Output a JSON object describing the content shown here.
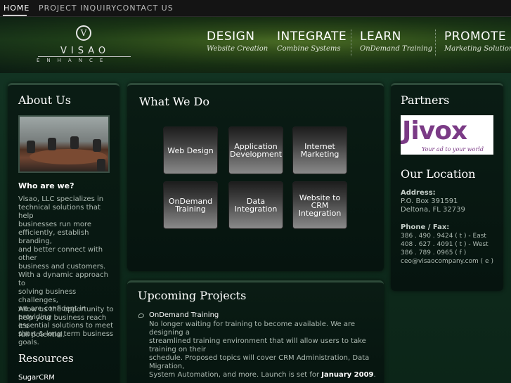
{
  "topnav": {
    "items": [
      "HOME",
      "PROJECT INQUIRY",
      "CONTACT US"
    ],
    "active": "HOME"
  },
  "logo": {
    "glyph": "V",
    "name": "VISAO",
    "sub": "ENHANCE"
  },
  "mainnav": [
    {
      "title": "DESIGN",
      "sub": "Website Creation"
    },
    {
      "title": "INTEGRATE",
      "sub": "Combine Systems"
    },
    {
      "title": "LEARN",
      "sub": "OnDemand Training"
    },
    {
      "title": "PROMOTE",
      "sub": "Marketing Solutions"
    }
  ],
  "about": {
    "heading": "About Us",
    "who_heading": "Who are we?",
    "paragraph1": [
      "Visao, LLC specializes in",
      "technical solutions that help",
      "businesses run more",
      "efficiently, establish branding,",
      "and better connect with other",
      "business and customers.",
      "With a dynamic approach to",
      "solving business challenges,",
      "we are confident in providing",
      "essential solutions to meet",
      "short & long term business",
      "goals."
    ],
    "paragraph2": [
      "Allow us the opportunity to",
      "help your business reach it's",
      "full potential."
    ],
    "resources_heading": "Resources",
    "resources_first": "SugarCRM"
  },
  "whatwedo": {
    "heading": "What We Do",
    "tiles": [
      [
        "Web Design"
      ],
      [
        "Application",
        "Development"
      ],
      [
        "Internet",
        "Marketing"
      ],
      [
        "OnDemand",
        "Training"
      ],
      [
        "Data",
        "Integration"
      ],
      [
        "Website to",
        "CRM",
        "Integration"
      ]
    ]
  },
  "upcoming": {
    "heading": "Upcoming Projects",
    "item_title": "OnDemand Training",
    "item_lines": [
      "No longer waiting for training to become available. We are designing a",
      "streamlined training environment that will allow users to take training on their",
      "schedule. Proposed topics will cover CRM Administration, Data Migration,"
    ],
    "last_line_prefix": "System Automation, and more. Launch is set for ",
    "last_line_bold": "January 2009",
    "last_line_suffix": "."
  },
  "partners": {
    "heading": "Partners",
    "logo_word": "Jivox",
    "logo_tag": "Your ad to your world"
  },
  "location": {
    "heading": "Our Location",
    "address_label": "Address:",
    "address_lines": [
      "P.O. Box 391591",
      "Deltona, FL 32739"
    ],
    "phone_label": "Phone / Fax:",
    "phone_lines": [
      "386 . 490 . 9424 ( t ) - East",
      "408 . 627 . 4091 ( t ) - West",
      "386 . 789 . 0965 ( f )",
      "ceo@visaocompany.com ( e )"
    ]
  },
  "colors": {
    "accent_purple": "#7b3b86",
    "panel_bg": "#06140f",
    "page_bg": "#0f2a1c"
  }
}
